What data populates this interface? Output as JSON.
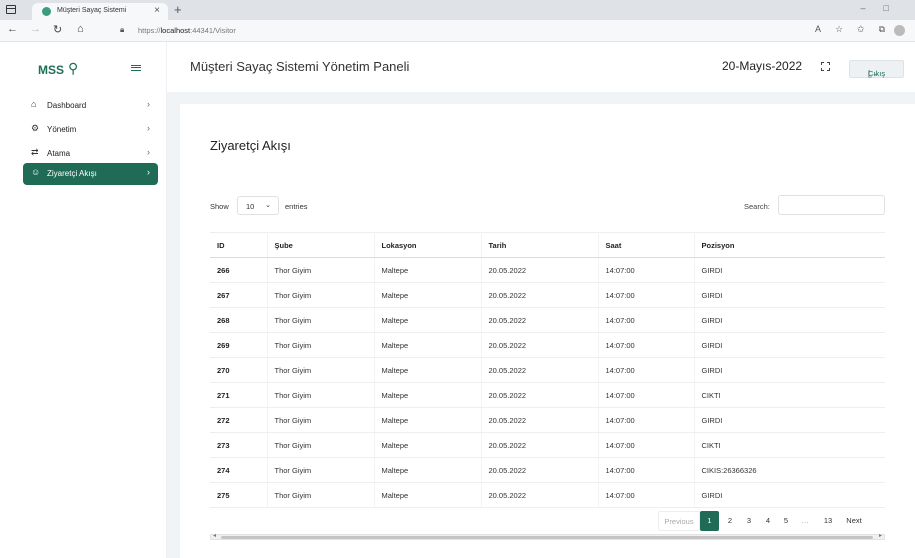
{
  "browser": {
    "tab_title": "Müşteri Sayaç Sistemi",
    "url_prefix": "https://",
    "url_host": "localhost",
    "url_path": ":44341/Visitor"
  },
  "sidebar": {
    "brand": "MSS",
    "items": [
      {
        "label": "Dashboard",
        "icon": "home-icon"
      },
      {
        "label": "Yönetim",
        "icon": "gear-icon"
      },
      {
        "label": "Atama",
        "icon": "swap-icon"
      },
      {
        "label": "Ziyaretçi Akışı",
        "icon": "users-icon",
        "active": true
      }
    ]
  },
  "header": {
    "title": "Müşteri Sayaç Sistemi Yönetim Paneli",
    "date": "20-Mayıs-2022",
    "logout_label": "Çıkış"
  },
  "card": {
    "title": "Ziyaretçi Akışı",
    "show_label": "Show",
    "page_length": "10",
    "entries_label": "entries",
    "search_label": "Search:"
  },
  "table": {
    "columns": [
      "ID",
      "Şube",
      "Lokasyon",
      "Tarih",
      "Saat",
      "Pozisyon"
    ],
    "rows": [
      [
        "266",
        "Thor Giyim",
        "Maltepe",
        "20.05.2022",
        "14:07:00",
        "GIRDI"
      ],
      [
        "267",
        "Thor Giyim",
        "Maltepe",
        "20.05.2022",
        "14:07:00",
        "GIRDI"
      ],
      [
        "268",
        "Thor Giyim",
        "Maltepe",
        "20.05.2022",
        "14:07:00",
        "GIRDI"
      ],
      [
        "269",
        "Thor Giyim",
        "Maltepe",
        "20.05.2022",
        "14:07:00",
        "GIRDI"
      ],
      [
        "270",
        "Thor Giyim",
        "Maltepe",
        "20.05.2022",
        "14:07:00",
        "GIRDI"
      ],
      [
        "271",
        "Thor Giyim",
        "Maltepe",
        "20.05.2022",
        "14:07:00",
        "CIKTI"
      ],
      [
        "272",
        "Thor Giyim",
        "Maltepe",
        "20.05.2022",
        "14:07:00",
        "GIRDI"
      ],
      [
        "273",
        "Thor Giyim",
        "Maltepe",
        "20.05.2022",
        "14:07:00",
        "CIKTI"
      ],
      [
        "274",
        "Thor Giyim",
        "Maltepe",
        "20.05.2022",
        "14:07:00",
        "CIKIS:26366326"
      ],
      [
        "275",
        "Thor Giyim",
        "Maltepe",
        "20.05.2022",
        "14:07:00",
        "GIRDI"
      ]
    ]
  },
  "pagination": {
    "previous": "Previous",
    "pages": [
      "1",
      "2",
      "3",
      "4",
      "5",
      "…",
      "13"
    ],
    "current": "1",
    "next": "Next"
  },
  "colors": {
    "accent": "#1f6b56",
    "brand": "#1e6e58"
  }
}
